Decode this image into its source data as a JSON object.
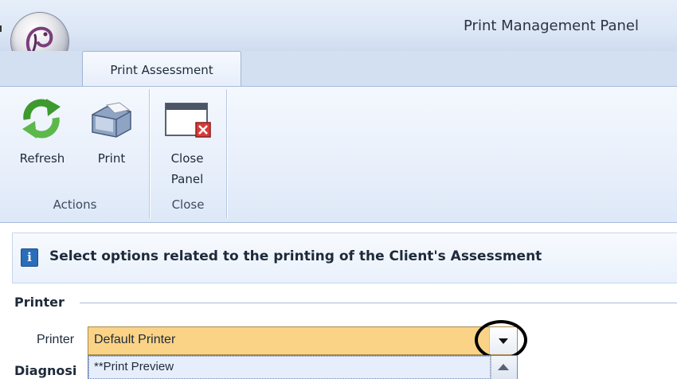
{
  "window": {
    "title": "Print Management Panel"
  },
  "app_menu": {
    "icon": "app-orb-logo-icon"
  },
  "ribbon": {
    "tabs": [
      {
        "label": "Print Assessment",
        "active": true
      }
    ],
    "groups": [
      {
        "label": "Actions",
        "buttons": [
          {
            "label": "Refresh",
            "icon": "refresh-icon"
          },
          {
            "label": "Print",
            "icon": "printer-icon"
          }
        ]
      },
      {
        "label": "Close",
        "buttons": [
          {
            "label_line1": "Close",
            "label_line2": "Panel",
            "icon": "close-panel-icon"
          }
        ]
      }
    ]
  },
  "banner": {
    "icon": "info-icon",
    "icon_glyph": "i",
    "text": "Select options related to the printing of the Client's Assessment"
  },
  "printer_group": {
    "title": "Printer",
    "field_label": "Printer",
    "selected": "Default Printer",
    "dropdown": {
      "open": true,
      "visible_items": [
        "**Print Preview"
      ]
    }
  },
  "diagnosis_group": {
    "title_visible": "Diagnosi"
  },
  "colors": {
    "combo_highlight": "#fbd386",
    "ribbon_bg": "#e9f0fb",
    "titlebar_bg": "#dce7f6",
    "info_icon": "#2a6db8"
  }
}
